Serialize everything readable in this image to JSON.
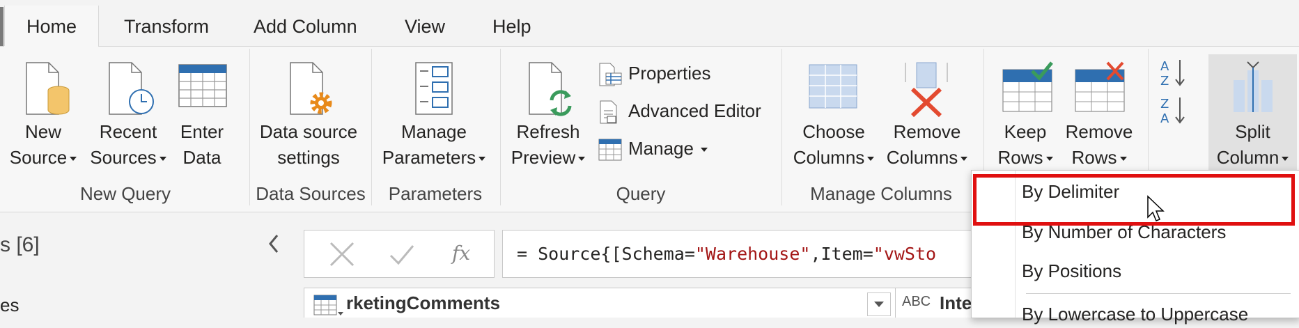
{
  "tabs": [
    {
      "label": "Home",
      "active": true
    },
    {
      "label": "Transform"
    },
    {
      "label": "Add Column"
    },
    {
      "label": "View"
    },
    {
      "label": "Help"
    }
  ],
  "groups": {
    "new_query": "New Query",
    "data_sources": "Data Sources",
    "parameters": "Parameters",
    "query": "Query",
    "manage_columns": "Manage Columns"
  },
  "buttons": {
    "new_source": [
      "New",
      "Source"
    ],
    "recent_sources": [
      "Recent",
      "Sources"
    ],
    "enter_data": [
      "Enter",
      "Data"
    ],
    "data_source_settings": [
      "Data source",
      "settings"
    ],
    "manage_parameters": [
      "Manage",
      "Parameters"
    ],
    "refresh_preview": [
      "Refresh",
      "Preview"
    ],
    "properties": "Properties",
    "advanced_editor": "Advanced Editor",
    "manage": "Manage",
    "choose_columns": [
      "Choose",
      "Columns"
    ],
    "remove_columns": [
      "Remove",
      "Columns"
    ],
    "keep_rows": [
      "Keep",
      "Rows"
    ],
    "remove_rows": [
      "Remove",
      "Rows"
    ],
    "split_column": [
      "Split",
      "Column"
    ]
  },
  "queries_pane": {
    "title": "s [6]",
    "item": "es"
  },
  "formula": {
    "prefix": "= Source{[Schema=",
    "schema_value": "\"Warehouse\"",
    "middle": ",Item=",
    "item_value": "\"vwSto"
  },
  "column_header": {
    "name": "rketingComments",
    "next_type": "ABC",
    "next_name": "Inte"
  },
  "split_menu": {
    "items": [
      "By Delimiter",
      "By Number of Characters",
      "By Positions",
      "By Lowercase to Uppercase"
    ]
  },
  "colors": {
    "accent_blue": "#2f6fb0",
    "highlight_red": "#e01010",
    "string_literal": "#a31515"
  }
}
